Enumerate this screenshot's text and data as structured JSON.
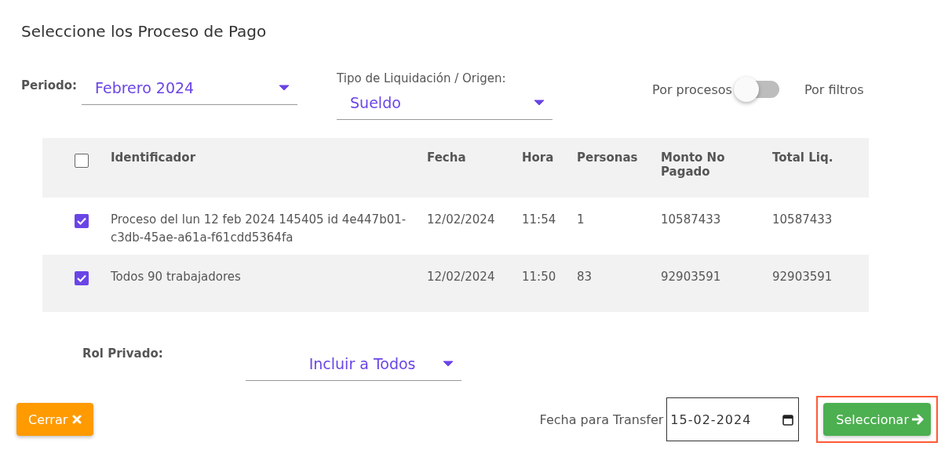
{
  "title": "Seleccione los Proceso de Pago",
  "periodo": {
    "label": "Periodo:",
    "value": "Febrero 2024"
  },
  "tipo": {
    "label": "Tipo de Liquidación / Origen:",
    "value": "Sueldo"
  },
  "mode_toggle": {
    "left_label": "Por procesos",
    "right_label": "Por filtros",
    "on": false
  },
  "table": {
    "select_all_checked": false,
    "columns": [
      "Identificador",
      "Fecha",
      "Hora",
      "Personas",
      "Monto No Pagado",
      "Total Liq."
    ],
    "rows": [
      {
        "checked": true,
        "cells": [
          "Proceso del lun 12 feb 2024 145405 id 4e447b01-c3db-45ae-a61a-f61cdd5364fa",
          "12/02/2024",
          "11:54",
          "1",
          "10587433",
          "10587433"
        ]
      },
      {
        "checked": true,
        "cells": [
          "Todos 90 trabajadores",
          "12/02/2024",
          "11:50",
          "83",
          "92903591",
          "92903591"
        ]
      }
    ]
  },
  "rol_privado": {
    "label": "Rol Privado:",
    "value": "Incluir a Todos"
  },
  "close_button": {
    "label": "Cerrar"
  },
  "transfer_date": {
    "label": "Fecha para Transfer",
    "value": "15-02-2024"
  },
  "select_button": {
    "label": "Seleccionar",
    "highlighted": true
  }
}
